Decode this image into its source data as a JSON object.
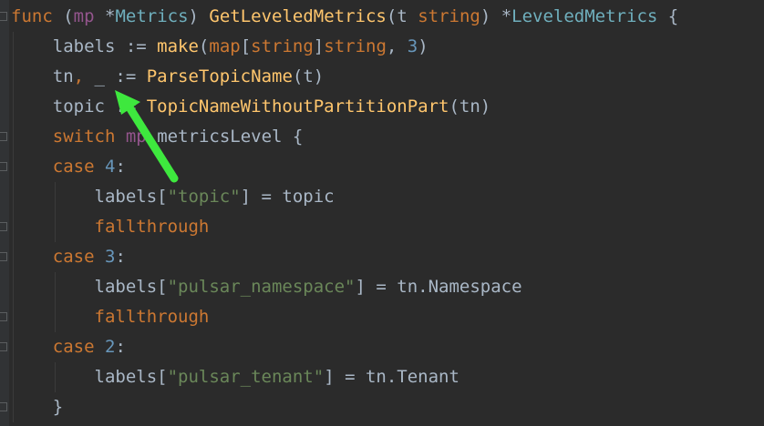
{
  "theme": {
    "background": "#2b2b2b",
    "keyword": "#cc7832",
    "function": "#ffc66d",
    "type": "#6fafbd",
    "param": "#94558d",
    "string": "#6a8759",
    "number": "#6897bb",
    "default": "#a9b7c6",
    "arrow": "#3ee83e"
  },
  "code": {
    "lines": [
      {
        "tokens": [
          {
            "t": "func",
            "k": "keyword"
          },
          {
            "t": " (",
            "k": "default"
          },
          {
            "t": "mp",
            "k": "param"
          },
          {
            "t": " *",
            "k": "default"
          },
          {
            "t": "Metrics",
            "k": "type"
          },
          {
            "t": ") ",
            "k": "default"
          },
          {
            "t": "GetLeveledMetrics",
            "k": "function"
          },
          {
            "t": "(t ",
            "k": "default"
          },
          {
            "t": "string",
            "k": "keyword"
          },
          {
            "t": ") *",
            "k": "default"
          },
          {
            "t": "LeveledMetrics",
            "k": "type"
          },
          {
            "t": " {",
            "k": "default"
          }
        ]
      },
      {
        "tokens": [
          {
            "t": "    labels := ",
            "k": "default"
          },
          {
            "t": "make",
            "k": "function"
          },
          {
            "t": "(",
            "k": "default"
          },
          {
            "t": "map",
            "k": "keyword"
          },
          {
            "t": "[",
            "k": "default"
          },
          {
            "t": "string",
            "k": "keyword"
          },
          {
            "t": "]",
            "k": "default"
          },
          {
            "t": "string",
            "k": "keyword"
          },
          {
            "t": ", ",
            "k": "default"
          },
          {
            "t": "3",
            "k": "number"
          },
          {
            "t": ")",
            "k": "default"
          }
        ]
      },
      {
        "tokens": [
          {
            "t": "    tn",
            "k": "default"
          },
          {
            "t": ", ",
            "k": "keyword"
          },
          {
            "t": "_ := ",
            "k": "default"
          },
          {
            "t": "ParseTopicName",
            "k": "function"
          },
          {
            "t": "(t)",
            "k": "default"
          }
        ]
      },
      {
        "tokens": [
          {
            "t": "    topic := ",
            "k": "default"
          },
          {
            "t": "TopicNameWithoutPartitionPart",
            "k": "function"
          },
          {
            "t": "(tn)",
            "k": "default"
          }
        ]
      },
      {
        "tokens": [
          {
            "t": "    ",
            "k": "default"
          },
          {
            "t": "switch",
            "k": "keyword"
          },
          {
            "t": " ",
            "k": "default"
          },
          {
            "t": "mp",
            "k": "param"
          },
          {
            "t": ".metricsLevel {",
            "k": "default"
          }
        ]
      },
      {
        "tokens": [
          {
            "t": "    ",
            "k": "default"
          },
          {
            "t": "case",
            "k": "keyword"
          },
          {
            "t": " ",
            "k": "default"
          },
          {
            "t": "4",
            "k": "number"
          },
          {
            "t": ":",
            "k": "default"
          }
        ]
      },
      {
        "tokens": [
          {
            "t": "        labels[",
            "k": "default"
          },
          {
            "t": "\"topic\"",
            "k": "string"
          },
          {
            "t": "] = topic",
            "k": "default"
          }
        ]
      },
      {
        "tokens": [
          {
            "t": "        ",
            "k": "default"
          },
          {
            "t": "fallthrough",
            "k": "keyword"
          }
        ]
      },
      {
        "tokens": [
          {
            "t": "    ",
            "k": "default"
          },
          {
            "t": "case",
            "k": "keyword"
          },
          {
            "t": " ",
            "k": "default"
          },
          {
            "t": "3",
            "k": "number"
          },
          {
            "t": ":",
            "k": "default"
          }
        ]
      },
      {
        "tokens": [
          {
            "t": "        labels[",
            "k": "default"
          },
          {
            "t": "\"pulsar_namespace\"",
            "k": "string"
          },
          {
            "t": "] = tn.Namespace",
            "k": "default"
          }
        ]
      },
      {
        "tokens": [
          {
            "t": "        ",
            "k": "default"
          },
          {
            "t": "fallthrough",
            "k": "keyword"
          }
        ]
      },
      {
        "tokens": [
          {
            "t": "    ",
            "k": "default"
          },
          {
            "t": "case",
            "k": "keyword"
          },
          {
            "t": " ",
            "k": "default"
          },
          {
            "t": "2",
            "k": "number"
          },
          {
            "t": ":",
            "k": "default"
          }
        ]
      },
      {
        "tokens": [
          {
            "t": "        labels[",
            "k": "default"
          },
          {
            "t": "\"pulsar_tenant\"",
            "k": "string"
          },
          {
            "t": "] = tn.Tenant",
            "k": "default"
          }
        ]
      },
      {
        "tokens": [
          {
            "t": "    }",
            "k": "default"
          }
        ]
      },
      {
        "tokens": [
          {
            "t": "",
            "k": "default"
          }
        ]
      }
    ]
  },
  "annotation": {
    "icon": "green-arrow-icon"
  }
}
